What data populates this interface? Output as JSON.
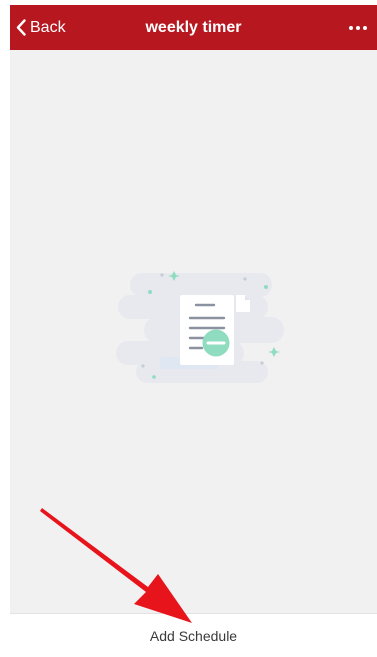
{
  "nav": {
    "back_label": "Back",
    "title": "weekly timer",
    "more_icon": "ellipsis-icon"
  },
  "empty_state": {
    "illustration_icon": "empty-document-icon"
  },
  "footer": {
    "add_schedule_label": "Add Schedule"
  },
  "annotation": {
    "arrow_icon": "red-arrow-icon"
  },
  "colors": {
    "nav_background": "#b7171f",
    "content_background": "#f1f1f1",
    "accent_mint": "#8fdcc0",
    "arrow_red": "#e8141c"
  }
}
